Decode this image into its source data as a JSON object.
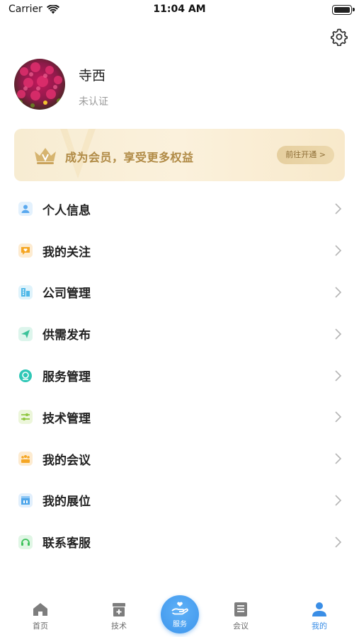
{
  "status_bar": {
    "carrier": "Carrier",
    "time": "11:04 AM"
  },
  "profile": {
    "name": "寺西",
    "status": "未认证"
  },
  "vip": {
    "text": "成为会员，享受更多权益",
    "button": "前往开通 >"
  },
  "menu": [
    {
      "label": "个人信息",
      "icon": "person-icon",
      "color": "#5aa9ef"
    },
    {
      "label": "我的关注",
      "icon": "heart-chat-icon",
      "color": "#f5a623"
    },
    {
      "label": "公司管理",
      "icon": "building-icon",
      "color": "#4fb8e8"
    },
    {
      "label": "供需发布",
      "icon": "send-icon",
      "color": "#3cc29a"
    },
    {
      "label": "服务管理",
      "icon": "service-icon",
      "color": "#2fc7b6"
    },
    {
      "label": "技术管理",
      "icon": "sliders-icon",
      "color": "#8fc63f"
    },
    {
      "label": "我的会议",
      "icon": "meeting-icon",
      "color": "#f5a623"
    },
    {
      "label": "我的展位",
      "icon": "booth-icon",
      "color": "#4fa6ea"
    },
    {
      "label": "联系客服",
      "icon": "headset-icon",
      "color": "#3cc25a"
    }
  ],
  "tabs": [
    {
      "label": "首页",
      "icon": "home-icon"
    },
    {
      "label": "技术",
      "icon": "tech-box-icon"
    },
    {
      "label": "服务",
      "icon": "service-hand-icon"
    },
    {
      "label": "会议",
      "icon": "meeting-doc-icon"
    },
    {
      "label": "我的",
      "icon": "profile-icon",
      "active": true
    }
  ],
  "colors": {
    "accent": "#3a8ee6",
    "vip_gold": "#b08a45"
  }
}
